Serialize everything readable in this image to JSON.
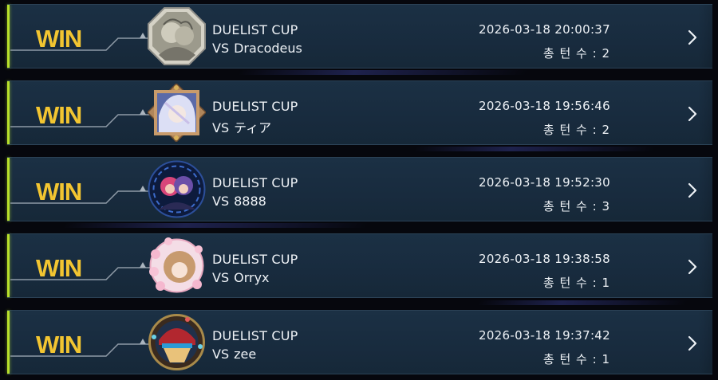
{
  "matches": [
    {
      "result": "WIN",
      "event": "DUELIST CUP",
      "vs_prefix": "VS",
      "opponent": "Dracodeus",
      "datetime": "2026-03-18 20:00:37",
      "turns_label": "총 턴 수 : 2",
      "avatar_icon": "monochrome-character-avatar-icon",
      "avatar_frame": "octagon-silver"
    },
    {
      "result": "WIN",
      "event": "DUELIST CUP",
      "vs_prefix": "VS",
      "opponent": "ティア",
      "datetime": "2026-03-18 19:56:46",
      "turns_label": "총 턴 수 : 2",
      "avatar_icon": "white-haired-character-avatar-icon",
      "avatar_frame": "diamond-bronze"
    },
    {
      "result": "WIN",
      "event": "DUELIST CUP",
      "vs_prefix": "VS",
      "opponent": "8888",
      "datetime": "2026-03-18 19:52:30",
      "turns_label": "총 턴 수 : 3",
      "avatar_icon": "twin-characters-avatar-icon",
      "avatar_frame": "round-vortex"
    },
    {
      "result": "WIN",
      "event": "DUELIST CUP",
      "vs_prefix": "VS",
      "opponent": "Orryx",
      "datetime": "2026-03-18 19:38:58",
      "turns_label": "총 턴 수 : 1",
      "avatar_icon": "sakura-character-avatar-icon",
      "avatar_frame": "round-blossom"
    },
    {
      "result": "WIN",
      "event": "DUELIST CUP",
      "vs_prefix": "VS",
      "opponent": "zee",
      "datetime": "2026-03-18 19:37:42",
      "turns_label": "총 턴 수 : 1",
      "avatar_icon": "helmeted-character-avatar-icon",
      "avatar_frame": "round-ornate"
    }
  ],
  "colors": {
    "win_text": "#f2c531",
    "accent_bar": "#b8e02b",
    "row_bg": "#1a2e42",
    "text": "#eef2f6"
  },
  "icons": {
    "chevron": "chevron-right-icon",
    "connector_marker": "triangle-marker-icon"
  }
}
